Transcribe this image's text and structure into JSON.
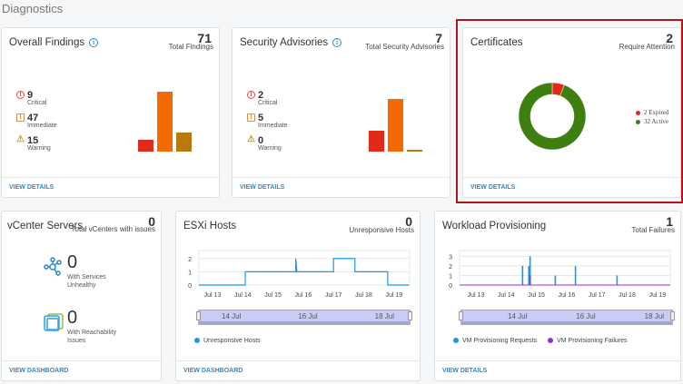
{
  "page_title": "Diagnostics",
  "overall_findings": {
    "title": "Overall Findings",
    "total": "71",
    "total_label": "Total Findings",
    "stats": [
      {
        "value": "9",
        "label": "Critical"
      },
      {
        "value": "47",
        "label": "Immediate"
      },
      {
        "value": "15",
        "label": "Warning"
      }
    ],
    "link": "VIEW DETAILS"
  },
  "security_advisories": {
    "title": "Security Advisories",
    "total": "7",
    "total_label": "Total Security Advisories",
    "stats": [
      {
        "value": "2",
        "label": "Critical"
      },
      {
        "value": "5",
        "label": "Immediate"
      },
      {
        "value": "0",
        "label": "Warning"
      }
    ],
    "link": "VIEW DETAILS"
  },
  "certificates": {
    "title": "Certificates",
    "total": "2",
    "total_label": "Require Attention",
    "legend": [
      {
        "label": "2 Expired",
        "value": 2,
        "color": "#e02a1a"
      },
      {
        "label": "32 Active",
        "value": 32,
        "color": "#3f7f12"
      }
    ],
    "link": "VIEW DETAILS",
    "highlight_color": "#b0161b"
  },
  "vcenter": {
    "title": "vCenter Servers",
    "total": "0",
    "total_label": "Total vCenters with issues",
    "stats": [
      {
        "value": "0",
        "label": "With Services Unhealthy",
        "icon": "network-services-icon"
      },
      {
        "value": "0",
        "label": "With Reachability Issues",
        "icon": "stacked-squares-icon"
      }
    ],
    "link": "VIEW DASHBOARD"
  },
  "esxi": {
    "title": "ESXi Hosts",
    "total": "0",
    "total_label": "Unresponsive Hosts",
    "link": "VIEW DASHBOARD",
    "legend": [
      {
        "label": "Unresponsive Hosts",
        "color": "#1a9be0"
      }
    ],
    "navigator_labels": [
      "14 Jul",
      "16 Jul",
      "18 Jul"
    ]
  },
  "workload": {
    "title": "Workload Provisioning",
    "total": "1",
    "total_label": "Total Failures",
    "link": "VIEW DETAILS",
    "legend": [
      {
        "label": "VM Provisioning Requests",
        "color": "#1a9be0"
      },
      {
        "label": "VM Provisioning Failures",
        "color": "#9a2fd0"
      }
    ],
    "navigator_labels": [
      "14 Jul",
      "16 Jul",
      "18 Jul"
    ]
  },
  "chart_data": [
    {
      "type": "bar",
      "categories": [
        "Critical",
        "Immediate",
        "Warning"
      ],
      "values": [
        9,
        47,
        15
      ],
      "colors": [
        "#e02a1a",
        "#f56a00",
        "#b87a0a"
      ]
    },
    {
      "type": "bar",
      "categories": [
        "Critical",
        "Immediate",
        "Warning"
      ],
      "values": [
        2,
        5,
        0
      ],
      "colors": [
        "#e02a1a",
        "#f56a00",
        "#b87a0a"
      ]
    },
    {
      "type": "pie",
      "categories": [
        "Expired",
        "Active"
      ],
      "values": [
        2,
        32
      ],
      "donut": true
    },
    {
      "type": "line",
      "step": true,
      "x_ticks": [
        "Jul 13",
        "Jul 14",
        "Jul 15",
        "Jul 16",
        "Jul 17",
        "Jul 18",
        "Jul 19"
      ],
      "y_ticks": [
        "0",
        "1",
        "2"
      ],
      "ylim": [
        0,
        2.6
      ],
      "series": [
        {
          "name": "Unresponsive Hosts",
          "points": [
            [
              "Jul 12 13:00",
              0
            ],
            [
              "Jul 14 02:00",
              0
            ],
            [
              "Jul 14 02:00",
              1
            ],
            [
              "Jul 15 18:00",
              1
            ],
            [
              "Jul 15 18:00",
              2
            ],
            [
              "Jul 15 19:00",
              1
            ],
            [
              "Jul 17 00:00",
              1
            ],
            [
              "Jul 17 00:00",
              2
            ],
            [
              "Jul 17 17:00",
              2
            ],
            [
              "Jul 17 17:00",
              1
            ],
            [
              "Jul 18 19:00",
              1
            ],
            [
              "Jul 18 19:00",
              0
            ],
            [
              "Jul 19 12:00",
              0
            ]
          ]
        }
      ]
    },
    {
      "type": "bar",
      "x_ticks": [
        "Jul 13",
        "Jul 14",
        "Jul 15",
        "Jul 16",
        "Jul 17",
        "Jul 18",
        "Jul 19"
      ],
      "y_ticks": [
        "0",
        "1",
        "2",
        "3"
      ],
      "ylim": [
        0,
        3.6
      ],
      "series": [
        {
          "name": "VM Provisioning Requests",
          "points": [
            [
              "Jul 14 13:00",
              2
            ],
            [
              "Jul 14 18:00",
              2
            ],
            [
              "Jul 14 19:00",
              3
            ],
            [
              "Jul 15 15:00",
              1
            ],
            [
              "Jul 16 07:00",
              2
            ],
            [
              "Jul 17 16:00",
              1
            ]
          ]
        },
        {
          "name": "VM Provisioning Failures",
          "points": [
            [
              "Jul 14 19:00",
              1
            ]
          ]
        }
      ]
    }
  ]
}
